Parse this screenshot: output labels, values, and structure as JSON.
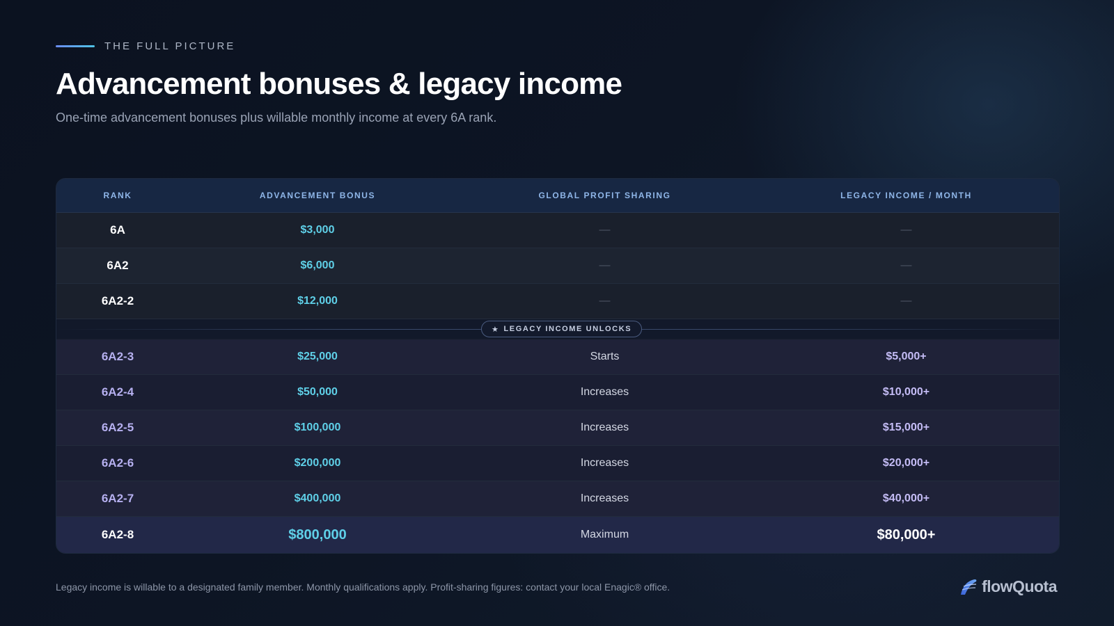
{
  "header": {
    "eyebrow": "THE FULL PICTURE",
    "title": "Advancement bonuses & legacy income",
    "subtitle": "One-time advancement bonuses plus willable monthly income at every 6A rank."
  },
  "table": {
    "columns": [
      "RANK",
      "ADVANCEMENT BONUS",
      "GLOBAL PROFIT SHARING",
      "LEGACY INCOME / MONTH"
    ],
    "divider_label": "LEGACY INCOME UNLOCKS",
    "rows": [
      {
        "rank": "6A",
        "bonus": "$3,000",
        "sharing": "—",
        "legacy": "—"
      },
      {
        "rank": "6A2",
        "bonus": "$6,000",
        "sharing": "—",
        "legacy": "—"
      },
      {
        "rank": "6A2-2",
        "bonus": "$12,000",
        "sharing": "—",
        "legacy": "—"
      },
      {
        "rank": "6A2-3",
        "bonus": "$25,000",
        "sharing": "Starts",
        "legacy": "$5,000+"
      },
      {
        "rank": "6A2-4",
        "bonus": "$50,000",
        "sharing": "Increases",
        "legacy": "$10,000+"
      },
      {
        "rank": "6A2-5",
        "bonus": "$100,000",
        "sharing": "Increases",
        "legacy": "$15,000+"
      },
      {
        "rank": "6A2-6",
        "bonus": "$200,000",
        "sharing": "Increases",
        "legacy": "$20,000+"
      },
      {
        "rank": "6A2-7",
        "bonus": "$400,000",
        "sharing": "Increases",
        "legacy": "$40,000+"
      },
      {
        "rank": "6A2-8",
        "bonus": "$800,000",
        "sharing": "Maximum",
        "legacy": "$80,000+"
      }
    ]
  },
  "footer": {
    "note": "Legacy income is willable to a designated family member. Monthly qualifications apply. Profit-sharing figures: contact your local Enagic® office.",
    "brand": "flowQuota"
  },
  "icons": {
    "brand_logo": "flowquota-logo-icon",
    "divider": "star-icon"
  },
  "colors": {
    "accent_cyan": "#5fd0e8",
    "accent_violet": "#b6b0f0",
    "header_blue": "#8fb6e8",
    "background": "#0d1524"
  }
}
